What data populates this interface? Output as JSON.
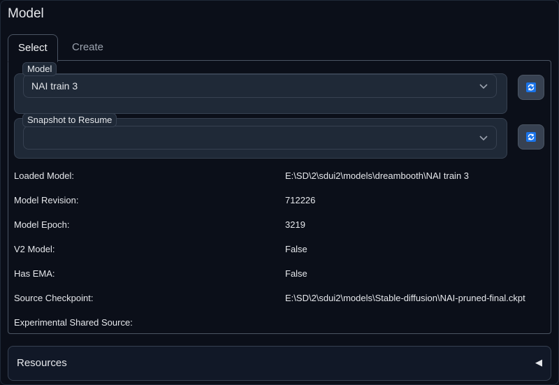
{
  "section_title": "Model",
  "tabs": [
    {
      "label": "Select",
      "selected": true
    },
    {
      "label": "Create",
      "selected": false
    }
  ],
  "model_select": {
    "label": "Model",
    "value": "NAI train 3"
  },
  "snapshot_select": {
    "label": "Snapshot to Resume",
    "value": ""
  },
  "refresh_icon": "refresh-icon",
  "info": [
    {
      "label": "Loaded Model:",
      "value": "E:\\SD\\2\\sdui2\\models\\dreambooth\\NAI train 3"
    },
    {
      "label": "Model Revision:",
      "value": "712226"
    },
    {
      "label": "Model Epoch:",
      "value": "3219"
    },
    {
      "label": "V2 Model:",
      "value": "False"
    },
    {
      "label": "Has EMA:",
      "value": "False"
    },
    {
      "label": "Source Checkpoint:",
      "value": "E:\\SD\\2\\sdui2\\models\\Stable-diffusion\\NAI-pruned-final.ckpt"
    },
    {
      "label": "Experimental Shared Source:",
      "value": ""
    }
  ],
  "resources": {
    "label": "Resources",
    "toggle": "◀"
  },
  "colors": {
    "background": "#0b0f19",
    "panel_border": "#4b5563",
    "input_bg": "#1f2937",
    "refresh_blue": "#1a73e8"
  }
}
